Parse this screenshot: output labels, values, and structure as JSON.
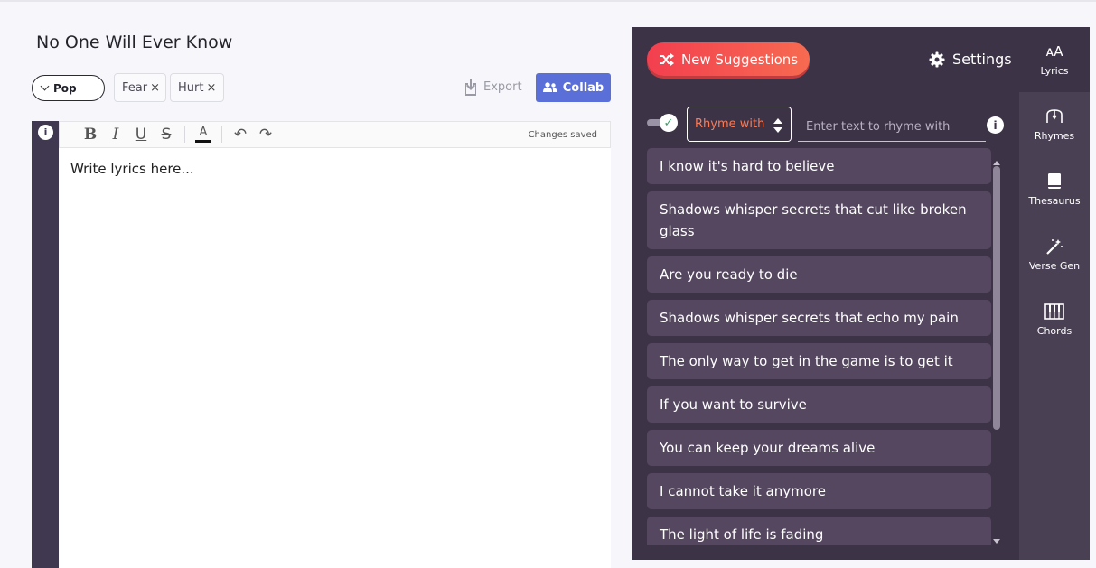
{
  "song": {
    "title": "No One Will Ever Know",
    "genre": "Pop",
    "tags": [
      "Fear",
      "Hurt"
    ],
    "tag_remove_symbol": "×"
  },
  "actions": {
    "export_label": "Export",
    "collab_label": "Collab"
  },
  "editor": {
    "info_symbol": "i",
    "toolbar": {
      "bold": "B",
      "italic": "I",
      "underline": "U",
      "strike": "S",
      "color": "A",
      "undo": "↶",
      "redo": "↷",
      "status": "Changes saved"
    },
    "placeholder": "Write lyrics here..."
  },
  "panel": {
    "new_suggestions_label": "New Suggestions",
    "settings_label": "Settings",
    "rhyme_mode": "Rhyme with",
    "rhyme_input_placeholder": "Enter text to rhyme with",
    "info_symbol": "i",
    "suggestions": [
      "I know it's hard to believe",
      "Shadows whisper secrets that cut like broken glass",
      "Are you ready to die",
      "Shadows whisper secrets that echo my pain",
      "The only way to get in the game is to get it",
      "If you want to survive",
      "You can keep your dreams alive",
      "I cannot take it anymore",
      "The light of life is fading"
    ]
  },
  "sidenav": {
    "items": [
      {
        "label": "Lyrics",
        "icon": "lyrics-icon",
        "glyph": "ᴀA"
      },
      {
        "label": "Rhymes",
        "icon": "rhymes-icon"
      },
      {
        "label": "Thesaurus",
        "icon": "book-icon"
      },
      {
        "label": "Verse Gen",
        "icon": "magic-wand-icon"
      },
      {
        "label": "Chords",
        "icon": "piano-icon"
      }
    ]
  },
  "colors": {
    "panel_bg": "#3d3347",
    "accent_orange": "#ff7a52",
    "collab_blue": "#5b6fd9",
    "suggestion_bg": "#54475f"
  }
}
